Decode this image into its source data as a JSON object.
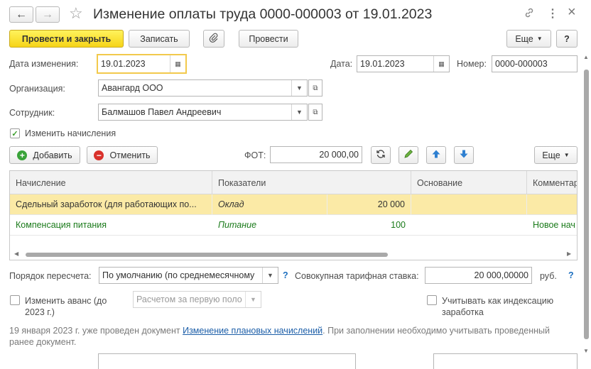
{
  "window": {
    "title": "Изменение оплаты труда 0000-000003 от 19.01.2023",
    "back_label": "←",
    "forward_label": "→",
    "star_label": "☆",
    "link_label": "🔗",
    "more_label": "⋮",
    "close_label": "×"
  },
  "toolbar": {
    "post_close": "Провести и закрыть",
    "save": "Записать",
    "attach_label": "📎",
    "post": "Провести",
    "more": "Еще",
    "help": "?"
  },
  "form": {
    "change_date_label": "Дата изменения:",
    "change_date_value": "19.01.2023",
    "date_label": "Дата:",
    "date_value": "19.01.2023",
    "number_label": "Номер:",
    "number_value": "0000-000003",
    "org_label": "Организация:",
    "org_value": "Авангард ООО",
    "employee_label": "Сотрудник:",
    "employee_value": "Балмашов Павел Андреевич",
    "change_accruals_label": "Изменить начисления",
    "change_accruals_checked": true
  },
  "accruals_toolbar": {
    "add": "Добавить",
    "cancel": "Отменить",
    "fot_label": "ФОТ:",
    "fot_value": "20 000,00",
    "more": "Еще"
  },
  "table": {
    "columns": [
      "Начисление",
      "Показатели",
      "Основание",
      "Комментар"
    ],
    "rows": [
      {
        "accrual": "Сдельный заработок (для работающих по...",
        "indicator": "Оклад",
        "value": "20 000",
        "basis": "",
        "comment": ""
      },
      {
        "accrual": "Компенсация питания",
        "indicator": "Питание",
        "value": "100",
        "basis": "",
        "comment": "Новое нач"
      }
    ]
  },
  "bottom": {
    "recalc_label": "Порядок пересчета:",
    "recalc_value": "По умолчанию (по среднемесячному",
    "tariff_label": "Совокупная тарифная ставка:",
    "tariff_value": "20 000,00000",
    "currency": "руб.",
    "advance_label_1": "Изменить аванс (до",
    "advance_label_2": "2023 г.)",
    "advance_value": "Расчетом за первую поло",
    "indexation_label_1": "Учитывать как индексацию",
    "indexation_label_2": "заработка",
    "notice_pre": "19 января 2023 г. уже проведен документ ",
    "notice_link": "Изменение плановых начислений",
    "notice_post": ". При заполнении необходимо учитывать проведенный",
    "notice_line2": "ранее документ."
  },
  "colors": {
    "primary_button": "#f6d418",
    "selected_row": "#fbeaa6",
    "link": "#1c5ea8",
    "add_icon": "#3aa33a",
    "cancel_icon": "#d9312b",
    "arrow_icon": "#2f80d1"
  }
}
